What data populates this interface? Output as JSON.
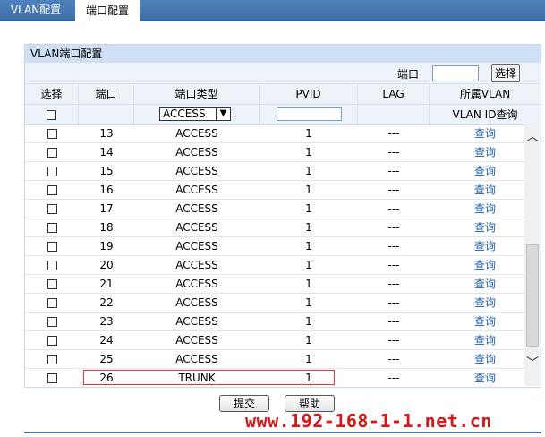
{
  "tabs": [
    {
      "label": "VLAN配置"
    },
    {
      "label": "端口配置"
    }
  ],
  "panel": {
    "title": "VLAN端口配置",
    "search_label": "端口",
    "search_button": "选择"
  },
  "columns": {
    "select": "选择",
    "port": "端口",
    "type": "端口类型",
    "pvid": "PVID",
    "lag": "LAG",
    "vlan": "所属VLAN"
  },
  "filter": {
    "type_value": "ACCESS",
    "vlan_id_query": "VLAN ID查询"
  },
  "rows": [
    {
      "port": "13",
      "type": "ACCESS",
      "pvid": "1",
      "lag": "---",
      "query": "查询"
    },
    {
      "port": "14",
      "type": "ACCESS",
      "pvid": "1",
      "lag": "---",
      "query": "查询"
    },
    {
      "port": "15",
      "type": "ACCESS",
      "pvid": "1",
      "lag": "---",
      "query": "查询"
    },
    {
      "port": "16",
      "type": "ACCESS",
      "pvid": "1",
      "lag": "---",
      "query": "查询"
    },
    {
      "port": "17",
      "type": "ACCESS",
      "pvid": "1",
      "lag": "---",
      "query": "查询"
    },
    {
      "port": "18",
      "type": "ACCESS",
      "pvid": "1",
      "lag": "---",
      "query": "查询"
    },
    {
      "port": "19",
      "type": "ACCESS",
      "pvid": "1",
      "lag": "---",
      "query": "查询"
    },
    {
      "port": "20",
      "type": "ACCESS",
      "pvid": "1",
      "lag": "---",
      "query": "查询"
    },
    {
      "port": "21",
      "type": "ACCESS",
      "pvid": "1",
      "lag": "---",
      "query": "查询"
    },
    {
      "port": "22",
      "type": "ACCESS",
      "pvid": "1",
      "lag": "---",
      "query": "查询"
    },
    {
      "port": "23",
      "type": "ACCESS",
      "pvid": "1",
      "lag": "---",
      "query": "查询"
    },
    {
      "port": "24",
      "type": "ACCESS",
      "pvid": "1",
      "lag": "---",
      "query": "查询"
    },
    {
      "port": "25",
      "type": "ACCESS",
      "pvid": "1",
      "lag": "---",
      "query": "查询"
    },
    {
      "port": "26",
      "type": "TRUNK",
      "pvid": "1",
      "lag": "---",
      "query": "查询"
    }
  ],
  "buttons": {
    "submit": "提交",
    "help": "帮助"
  },
  "watermark": "www.192-168-1-1.net.cn",
  "icons": {
    "select_arrow": "chevron-down-icon",
    "scroll_up": "chevron-up-icon",
    "scroll_down": "chevron-down-icon"
  }
}
